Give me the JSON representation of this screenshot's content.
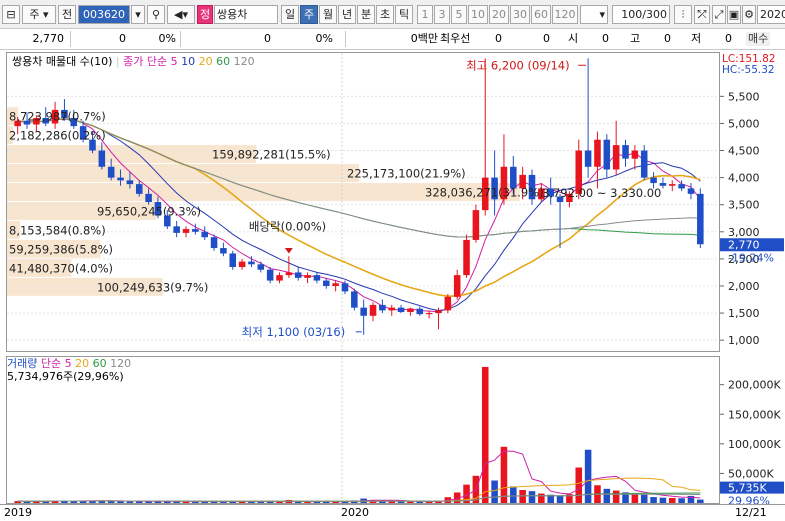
{
  "toolbar": {
    "icon_menu": "⊟",
    "type_label": "주",
    "period_label": "전",
    "stock_code": "003620",
    "stock_badge": "정",
    "stock_name": "쌍용차",
    "tf_day": "일",
    "tf_week": "주",
    "tf_month": "월",
    "tf_year": "년",
    "tf_min": "분",
    "tf_sec": "초",
    "tf_tick": "틱",
    "intervals": [
      "1",
      "3",
      "5",
      "10",
      "20",
      "30",
      "60",
      "120"
    ],
    "count_value": "100",
    "count_total": "/300",
    "date_value": "2020/"
  },
  "info": {
    "price": "2,770",
    "change": "0",
    "change_pct": "0%",
    "volume": "0",
    "volume_pct": "0%",
    "amount": "0백만",
    "best_bid_label": "최우선",
    "best_bid": "0",
    "open_label": "시",
    "open": "0",
    "high_label": "고",
    "high": "0",
    "low_label": "저",
    "low": "0",
    "sell_label": "매수"
  },
  "price_chart": {
    "title": "쌍용차 매물대 수(10)",
    "ma_label": "종가 단순",
    "ma_periods": [
      "5",
      "10",
      "20",
      "60",
      "120"
    ],
    "lc": "LC:151.82",
    "hc": "HC:-55.32",
    "max_label": "최고 6,200 (09/14)",
    "min_label": "최저 1,100 (03/16)",
    "dividend_label": "배당락(0.00%)",
    "current_price": "2,770",
    "current_change": "-19.24%"
  },
  "volume_profile": [
    {
      "label": "8,723,987(0.7%)",
      "value": 8723987,
      "pct": 0.7
    },
    {
      "label": "2,182,286(0.2%)",
      "value": 2182286,
      "pct": 0.2
    },
    {
      "label": "159,892,281(15.5%)",
      "value": 159892281,
      "pct": 15.5
    },
    {
      "label": "225,173,100(21.9%)",
      "value": 225173100,
      "pct": 21.9
    },
    {
      "label": "328,036,271(31.9%)",
      "value": 328036271,
      "pct": 31.9
    },
    {
      "label": "95,650,245(9.3%)",
      "value": 95650245,
      "pct": 9.3
    },
    {
      "label": "8,153,584(0.8%)",
      "value": 8153584,
      "pct": 0.8
    },
    {
      "label": "59,259,386(5.8%)",
      "value": 59259386,
      "pct": 5.8
    },
    {
      "label": "41,480,370(4.0%)",
      "value": 41480370,
      "pct": 4.0
    },
    {
      "label": "100,249,633(9.7%)",
      "value": 100249633,
      "pct": 9.7
    }
  ],
  "range_label": "3,792.00 ~ 3,330.00",
  "volume_chart": {
    "title": "거래량",
    "ma_label": "단순",
    "ma_periods": [
      "5",
      "20",
      "60",
      "120"
    ],
    "current_label": "5,734,976주(29,96%)",
    "current_value": "5,735K",
    "current_pct": "29.96%"
  },
  "date_axis": [
    "2019",
    "2020",
    "12/21"
  ],
  "colors": {
    "up": "#e8141e",
    "down": "#1f4ec7",
    "ma5": "#d020a8",
    "ma10": "#2437b3",
    "ma20": "#e6a817",
    "ma60": "#2e9a45",
    "ma120": "#8a8a8a",
    "profile": "#f7e5cf"
  },
  "chart_data": {
    "type": "candlestick",
    "period": "weekly",
    "y_ticks": [
      1000,
      1500,
      2000,
      2500,
      3000,
      3500,
      4000,
      4500,
      5000,
      5500
    ],
    "ylim": [
      800,
      6300
    ],
    "volume_ticks": [
      "50,000K",
      "100,000K",
      "150,000K",
      "200,000K"
    ],
    "volume_ylim": [
      0,
      240000
    ],
    "x_labels": [
      "2019",
      "2020",
      "12/21"
    ],
    "candles": [
      [
        4950,
        5120,
        4800,
        5050,
        3200
      ],
      [
        5050,
        5200,
        4900,
        4980,
        2800
      ],
      [
        4980,
        5150,
        4850,
        5100,
        3500
      ],
      [
        5100,
        5300,
        4950,
        5000,
        2900
      ],
      [
        5000,
        5400,
        4900,
        5250,
        4100
      ],
      [
        5250,
        5450,
        5050,
        5100,
        3600
      ],
      [
        5100,
        5250,
        4900,
        4950,
        3200
      ],
      [
        4950,
        5050,
        4650,
        4700,
        3800
      ],
      [
        4700,
        4850,
        4450,
        4500,
        3500
      ],
      [
        4500,
        4650,
        4150,
        4200,
        4200
      ],
      [
        4200,
        4350,
        3950,
        4000,
        3900
      ],
      [
        4000,
        4150,
        3850,
        3950,
        2600
      ],
      [
        3950,
        4100,
        3800,
        3880,
        2400
      ],
      [
        3880,
        3950,
        3650,
        3700,
        3000
      ],
      [
        3700,
        3800,
        3500,
        3550,
        2800
      ],
      [
        3550,
        3650,
        3250,
        3300,
        3300
      ],
      [
        3300,
        3400,
        3050,
        3100,
        3400
      ],
      [
        3100,
        3200,
        2900,
        2980,
        3100
      ],
      [
        2980,
        3100,
        2900,
        3050,
        2200
      ],
      [
        3050,
        3150,
        2950,
        3000,
        2000
      ],
      [
        3000,
        3100,
        2850,
        2900,
        2100
      ],
      [
        2900,
        2950,
        2650,
        2700,
        2900
      ],
      [
        2700,
        2800,
        2550,
        2600,
        2700
      ],
      [
        2600,
        2650,
        2300,
        2350,
        3400
      ],
      [
        2350,
        2500,
        2300,
        2450,
        2500
      ],
      [
        2450,
        2550,
        2350,
        2400,
        2200
      ],
      [
        2400,
        2450,
        2250,
        2300,
        2300
      ],
      [
        2300,
        2350,
        2050,
        2100,
        2900
      ],
      [
        2100,
        2250,
        2050,
        2200,
        2400
      ],
      [
        2200,
        2550,
        2150,
        2250,
        5100
      ],
      [
        2250,
        2350,
        2100,
        2150,
        2600
      ],
      [
        2150,
        2250,
        2050,
        2200,
        2000
      ],
      [
        2200,
        2250,
        2050,
        2100,
        2100
      ],
      [
        2100,
        2150,
        1950,
        2000,
        2600
      ],
      [
        2000,
        2100,
        1900,
        2050,
        2500
      ],
      [
        2050,
        2100,
        1850,
        1900,
        2900
      ],
      [
        1900,
        1950,
        1550,
        1600,
        4300
      ],
      [
        1600,
        1750,
        1100,
        1450,
        7500
      ],
      [
        1450,
        1700,
        1350,
        1650,
        5200
      ],
      [
        1650,
        1750,
        1500,
        1550,
        3900
      ],
      [
        1550,
        1650,
        1450,
        1600,
        3100
      ],
      [
        1600,
        1650,
        1500,
        1520,
        2600
      ],
      [
        1520,
        1600,
        1450,
        1580,
        2400
      ],
      [
        1580,
        1620,
        1450,
        1480,
        2300
      ],
      [
        1480,
        1550,
        1400,
        1500,
        2200
      ],
      [
        1500,
        1600,
        1200,
        1550,
        4100
      ],
      [
        1550,
        1850,
        1500,
        1800,
        9800
      ],
      [
        1800,
        2300,
        1750,
        2200,
        17800
      ],
      [
        2200,
        2950,
        2150,
        2850,
        31000
      ],
      [
        2850,
        3500,
        2800,
        3400,
        46000
      ],
      [
        3400,
        6200,
        3300,
        4000,
        230000
      ],
      [
        4000,
        4500,
        3300,
        3600,
        38000
      ],
      [
        3600,
        4800,
        3500,
        4200,
        95000
      ],
      [
        4200,
        4400,
        3700,
        3800,
        28000
      ],
      [
        3800,
        4200,
        3600,
        4050,
        22000
      ],
      [
        4050,
        4150,
        3500,
        3600,
        20000
      ],
      [
        3600,
        3900,
        3550,
        3800,
        16000
      ],
      [
        3800,
        4000,
        3500,
        3650,
        14000
      ],
      [
        3650,
        3700,
        2700,
        3550,
        12000
      ],
      [
        3550,
        3750,
        3450,
        3700,
        15000
      ],
      [
        3700,
        4700,
        3600,
        4500,
        60000
      ],
      [
        4500,
        6200,
        4000,
        4200,
        90000
      ],
      [
        4200,
        4850,
        3800,
        4700,
        30000
      ],
      [
        4700,
        4800,
        4000,
        4150,
        24000
      ],
      [
        4150,
        5050,
        4050,
        4600,
        21000
      ],
      [
        4600,
        4700,
        4200,
        4350,
        18000
      ],
      [
        4350,
        4600,
        4150,
        4500,
        15000
      ],
      [
        4500,
        4600,
        3950,
        4000,
        14000
      ],
      [
        4000,
        4100,
        3800,
        3900,
        10000
      ],
      [
        3900,
        4000,
        3800,
        3850,
        9000
      ],
      [
        3850,
        3950,
        3750,
        3880,
        8500
      ],
      [
        3880,
        3950,
        3750,
        3800,
        8000
      ],
      [
        3800,
        3900,
        3600,
        3700,
        12000
      ],
      [
        3700,
        3800,
        2700,
        2770,
        5735
      ]
    ]
  }
}
